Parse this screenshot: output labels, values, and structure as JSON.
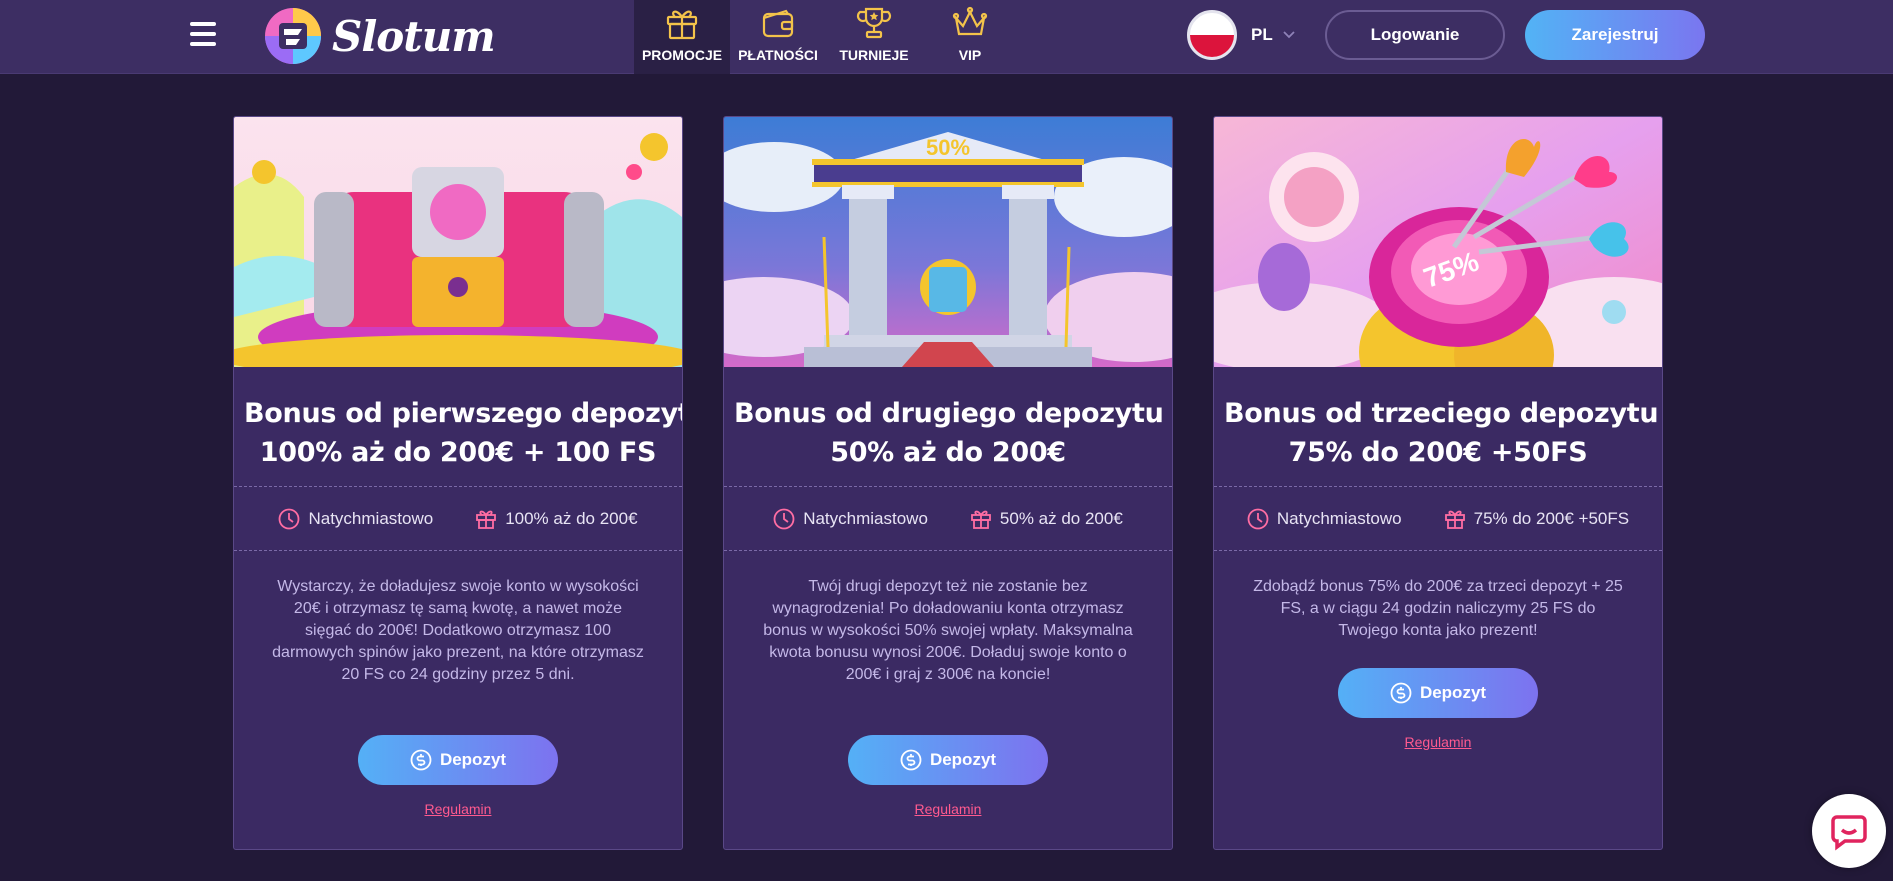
{
  "header": {
    "logo_text": "Slotum",
    "nav": [
      {
        "label": "PROMOCJE",
        "icon": "gift-icon",
        "active": true
      },
      {
        "label": "PŁATNOŚCI",
        "icon": "wallet-icon",
        "active": false
      },
      {
        "label": "TURNIEJE",
        "icon": "trophy-icon",
        "active": false
      },
      {
        "label": "VIP",
        "icon": "crown-icon",
        "active": false
      }
    ],
    "language": "PL",
    "login_label": "Logowanie",
    "register_label": "Zarejestruj"
  },
  "cards": [
    {
      "title_line1": "Bonus od pierwszego depozytu",
      "title_line2": "100% aż do 200€ + 100 FS",
      "time": "Natychmiastowo",
      "bonus": "100% aż do 200€",
      "description": "Wystarczy, że doładujesz swoje konto w wysokości 20€ i otrzymasz tę samą kwotę, a nawet może sięgać do 200€! Dodatkowo otrzymasz 100 darmowych spinów jako prezent, na które otrzymasz 20 FS co 24 godziny przez 5 dni.",
      "button_label": "Depozyt",
      "terms_label": "Regulamin"
    },
    {
      "title_line1": "Bonus od drugiego depozytu",
      "title_line2": "50% aż do 200€",
      "time": "Natychmiastowo",
      "bonus": "50% aż do 200€",
      "description": "Twój drugi depozyt też nie zostanie bez wynagrodzenia! Po doładowaniu konta otrzymasz bonus w wysokości 50% swojej wpłaty. Maksymalna kwota bonusu wynosi 200€. Doładuj swoje konto o 200€ i graj z 300€ na koncie!",
      "button_label": "Depozyt",
      "terms_label": "Regulamin"
    },
    {
      "title_line1": "Bonus od trzeciego depozytu",
      "title_line2": "75% do 200€ +50FS",
      "time": "Natychmiastowo",
      "bonus": "75% do 200€ +50FS",
      "description": "Zdobądź bonus 75% do 200€ za trzeci depozyt + 25 FS, a w ciągu 24 godzin naliczymy 25 FS do Twojego konta jako prezent!",
      "button_label": "Depozyt",
      "terms_label": "Regulamin"
    }
  ],
  "card_images": [
    {
      "label": "",
      "badge": ""
    },
    {
      "label": "",
      "badge": "50%"
    },
    {
      "label": "",
      "badge": "75%"
    }
  ],
  "colors": {
    "page_bg": "#221938",
    "header_bg": "#3d2e63",
    "card_bg": "#3b2a63",
    "accent_gradient_start": "#54b0f6",
    "accent_gradient_end": "#7d72ef",
    "terms_link": "#ff5a8f"
  },
  "chat_icon": "chat-bubble-icon"
}
